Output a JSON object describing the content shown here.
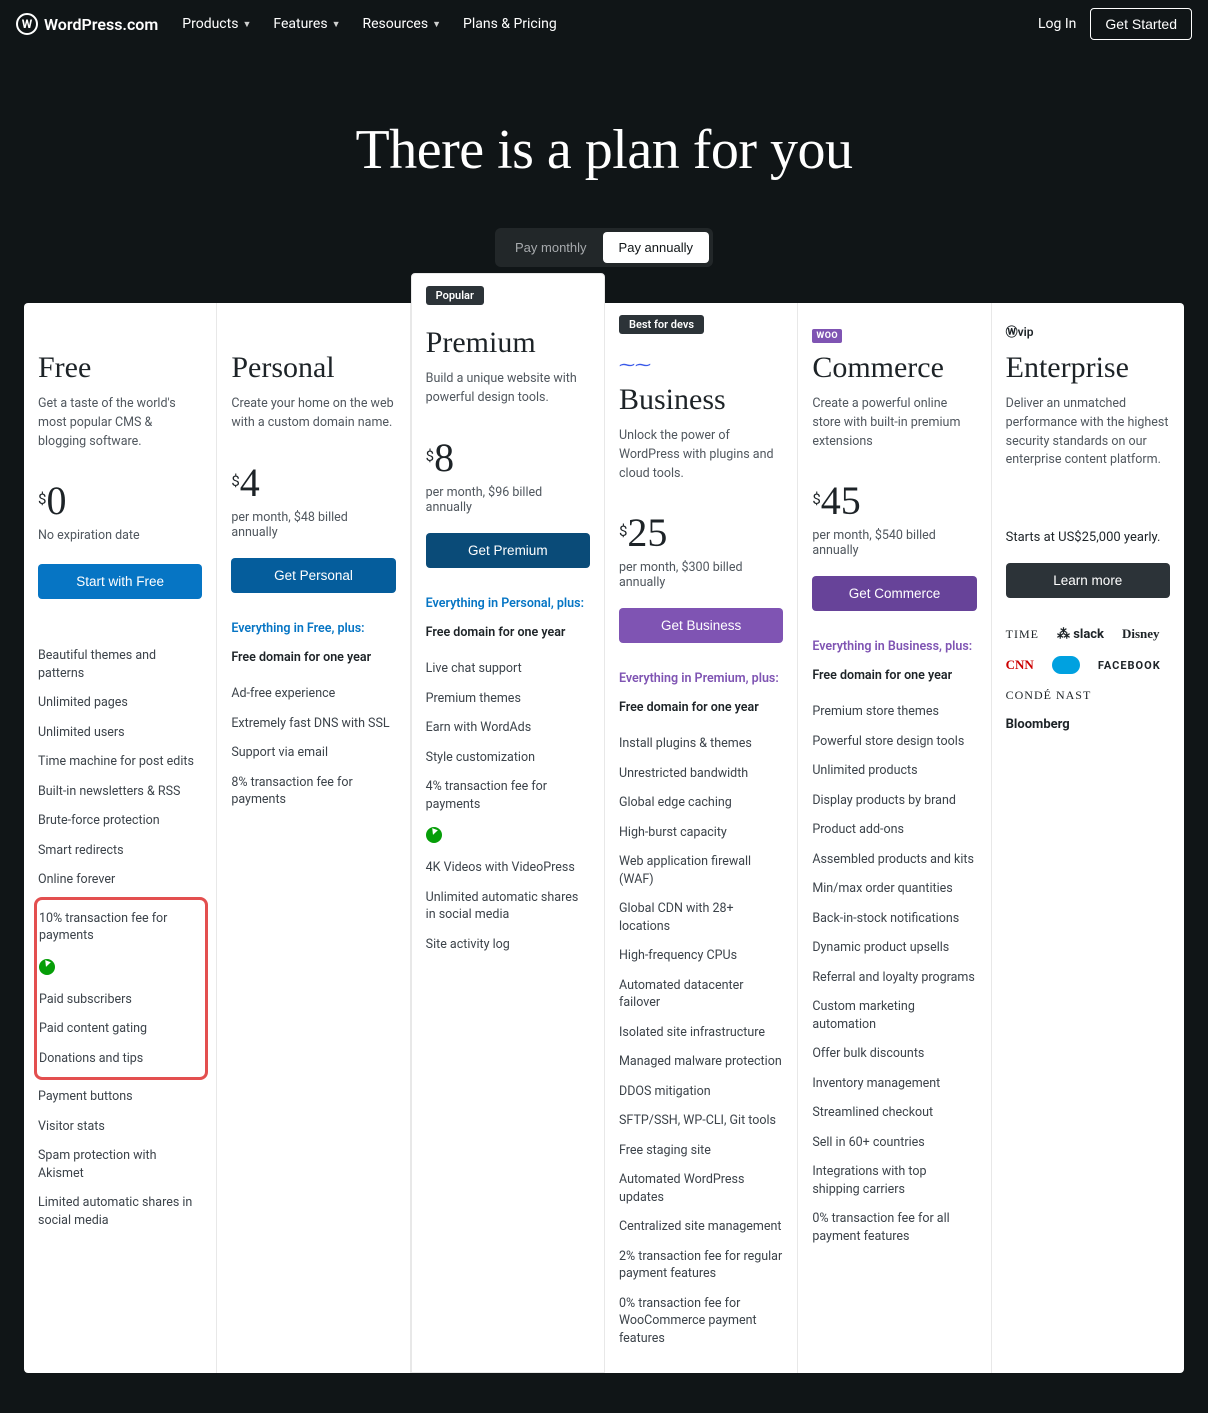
{
  "brand": "WordPress.com",
  "nav": {
    "items": [
      "Products",
      "Features",
      "Resources",
      "Plans & Pricing"
    ],
    "login": "Log In",
    "get_started": "Get Started"
  },
  "hero": {
    "title": "There is a plan for you",
    "toggle": {
      "monthly": "Pay monthly",
      "annually": "Pay annually"
    }
  },
  "plans": {
    "free": {
      "name": "Free",
      "desc": "Get a taste of the world's most popular CMS & blogging software.",
      "currency": "$",
      "price": "0",
      "note": "No expiration date",
      "cta": "Start with Free",
      "features_top": [
        "Beautiful themes and patterns",
        "Unlimited pages",
        "Unlimited users",
        "Time machine for post edits",
        "Built-in newsletters & RSS",
        "Brute-force protection",
        "Smart redirects",
        "Online forever"
      ],
      "highlight": [
        "10% transaction fee for payments",
        "Paid subscribers",
        "Paid content gating",
        "Donations and tips"
      ],
      "features_bottom": [
        "Payment buttons",
        "Visitor stats",
        "Spam protection with Akismet",
        "Limited automatic shares in social media"
      ]
    },
    "personal": {
      "name": "Personal",
      "desc": "Create your home on the web with a custom domain name.",
      "currency": "$",
      "price": "4",
      "note": "per month, $48 billed annually",
      "cta": "Get Personal",
      "inherits": "Everything in Free, plus:",
      "domain": "Free domain for one year",
      "features": [
        "Ad-free experience",
        "Extremely fast DNS with SSL",
        "Support via email",
        "8% transaction fee for payments"
      ]
    },
    "premium": {
      "tag": "Popular",
      "name": "Premium",
      "desc": "Build a unique website with powerful design tools.",
      "currency": "$",
      "price": "8",
      "note": "per month, $96 billed annually",
      "cta": "Get Premium",
      "inherits": "Everything in Personal, plus:",
      "domain": "Free domain for one year",
      "features_a": [
        "Live chat support",
        "Premium themes",
        "Earn with WordAds",
        "Style customization",
        "4% transaction fee for payments"
      ],
      "features_b": [
        "4K Videos with VideoPress",
        "Unlimited automatic shares in social media",
        "Site activity log"
      ]
    },
    "business": {
      "tag": "Best for devs",
      "name": "Business",
      "desc": "Unlock the power of WordPress with plugins and cloud tools.",
      "currency": "$",
      "price": "25",
      "note": "per month, $300 billed annually",
      "cta": "Get Business",
      "inherits": "Everything in Premium, plus:",
      "domain": "Free domain for one year",
      "features": [
        "Install plugins & themes",
        "Unrestricted bandwidth",
        "Global edge caching",
        "High-burst capacity",
        "Web application firewall (WAF)",
        "Global CDN with 28+ locations",
        "High-frequency CPUs",
        "Automated datacenter failover",
        "Isolated site infrastructure",
        "Managed malware protection",
        "DDOS mitigation",
        "SFTP/SSH, WP-CLI, Git tools",
        "Free staging site",
        "Automated WordPress updates",
        "Centralized site management",
        "2% transaction fee for regular payment features",
        "0% transaction fee for WooCommerce payment features"
      ]
    },
    "commerce": {
      "name": "Commerce",
      "desc": "Create a powerful online store with built-in premium extensions",
      "currency": "$",
      "price": "45",
      "note": "per month, $540 billed annually",
      "cta": "Get Commerce",
      "inherits": "Everything in Business, plus:",
      "domain": "Free domain for one year",
      "features": [
        "Premium store themes",
        "Powerful store design tools",
        "Unlimited products",
        "Display products by brand",
        "Product add-ons",
        "Assembled products and kits",
        "Min/max order quantities",
        "Back-in-stock notifications",
        "Dynamic product upsells",
        "Referral and loyalty programs",
        "Custom marketing automation",
        "Offer bulk discounts",
        "Inventory management",
        "Streamlined checkout",
        "Sell in 60+ countries",
        "Integrations with top shipping carriers",
        "0% transaction fee for all payment features"
      ]
    },
    "enterprise": {
      "name": "Enterprise",
      "desc": "Deliver an unmatched performance with the highest security standards on our enterprise content platform.",
      "price_note": "Starts at US$25,000 yearly.",
      "cta": "Learn more",
      "brands": [
        "TIME",
        "slack",
        "Disney",
        "CNN",
        "salesforce",
        "FACEBOOK",
        "CONDÉ NAST",
        "Bloomberg"
      ]
    }
  }
}
